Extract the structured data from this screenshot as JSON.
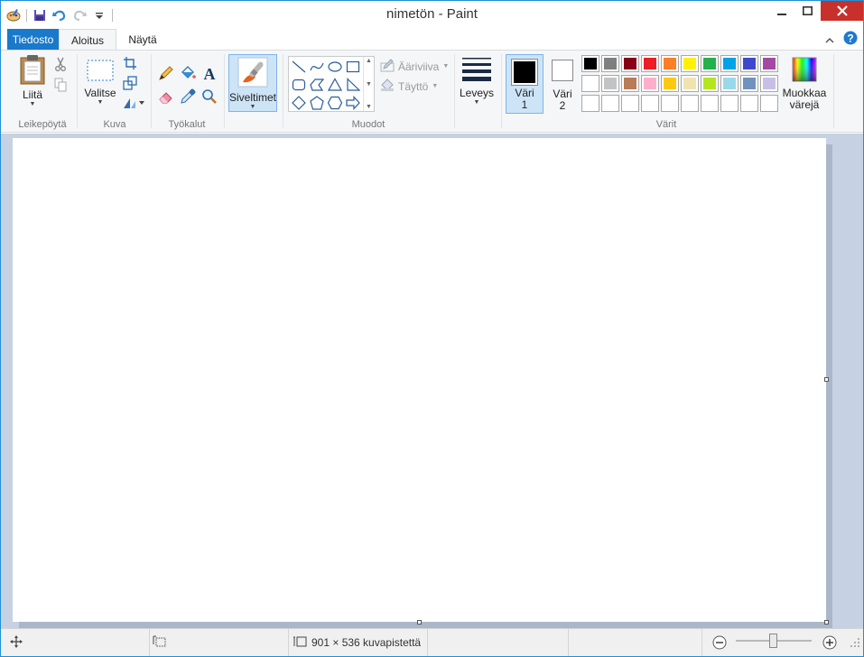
{
  "window": {
    "title": "nimetön - Paint",
    "accent": "#1979ca",
    "close_color": "#c8302b"
  },
  "quick_access": {
    "icons": [
      "paint-app-icon",
      "save-icon",
      "undo-icon",
      "redo-icon",
      "customize-dropdown-icon"
    ]
  },
  "tabs": {
    "file": "Tiedosto",
    "home": "Aloitus",
    "view": "Näytä"
  },
  "clipboard": {
    "paste_label": "Liitä",
    "group_label": "Leikepöytä"
  },
  "image": {
    "select_label": "Valitse",
    "group_label": "Kuva"
  },
  "tools": {
    "group_label": "Työkalut"
  },
  "brushes": {
    "label": "Siveltimet"
  },
  "shapes": {
    "outline_label": "Ääriviiva",
    "fill_label": "Täyttö",
    "group_label": "Muodot"
  },
  "size": {
    "label": "Leveys"
  },
  "colors": {
    "color1_label_line1": "Väri",
    "color1_label_line2": "1",
    "color2_label_line1": "Väri",
    "color2_label_line2": "2",
    "color1_value": "#000000",
    "color2_value": "#ffffff",
    "edit_label_line1": "Muokkaa",
    "edit_label_line2": "värejä",
    "group_label": "Värit",
    "palette_row1": [
      "#000000",
      "#7f7f7f",
      "#880015",
      "#ed1c24",
      "#ff7f27",
      "#fff200",
      "#22b14c",
      "#00a2e8",
      "#3f48cc",
      "#a349a4"
    ],
    "palette_row2": [
      "#ffffff",
      "#c3c3c3",
      "#b97a57",
      "#ffaec9",
      "#ffc90e",
      "#efe4b0",
      "#b5e61d",
      "#99d9ea",
      "#7092be",
      "#c8bfe7"
    ],
    "palette_row3": [
      "",
      "",
      "",
      "",
      "",
      "",
      "",
      "",
      "",
      ""
    ]
  },
  "status": {
    "canvas_size": "901 × 536 kuvapistettä"
  }
}
